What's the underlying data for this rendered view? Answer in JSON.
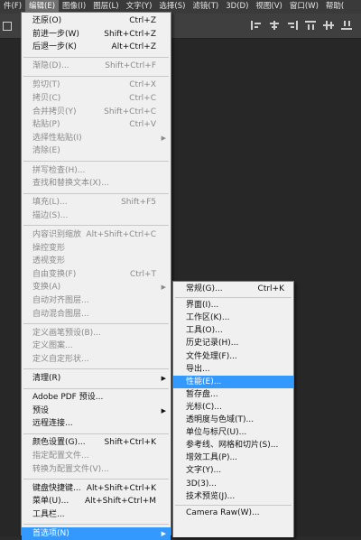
{
  "menubar": {
    "items": [
      {
        "label": "件(F)",
        "active": false
      },
      {
        "label": "编辑(E)",
        "active": true
      },
      {
        "label": "图像(I)",
        "active": false
      },
      {
        "label": "图层(L)",
        "active": false
      },
      {
        "label": "文字(Y)",
        "active": false
      },
      {
        "label": "选择(S)",
        "active": false
      },
      {
        "label": "滤镜(T)",
        "active": false
      },
      {
        "label": "3D(D)",
        "active": false
      },
      {
        "label": "视图(V)",
        "active": false
      },
      {
        "label": "窗口(W)",
        "active": false
      },
      {
        "label": "帮助(",
        "active": false
      }
    ]
  },
  "edit_menu": {
    "items": [
      {
        "label": "还原(O)",
        "shortcut": "Ctrl+Z",
        "disabled": false
      },
      {
        "label": "前进一步(W)",
        "shortcut": "Shift+Ctrl+Z",
        "disabled": false
      },
      {
        "label": "后退一步(K)",
        "shortcut": "Alt+Ctrl+Z",
        "disabled": false
      },
      {
        "sep": true
      },
      {
        "label": "渐隐(D)...",
        "shortcut": "Shift+Ctrl+F",
        "disabled": true
      },
      {
        "sep": true
      },
      {
        "label": "剪切(T)",
        "shortcut": "Ctrl+X",
        "disabled": true
      },
      {
        "label": "拷贝(C)",
        "shortcut": "Ctrl+C",
        "disabled": true
      },
      {
        "label": "合并拷贝(Y)",
        "shortcut": "Shift+Ctrl+C",
        "disabled": true
      },
      {
        "label": "粘贴(P)",
        "shortcut": "Ctrl+V",
        "disabled": true
      },
      {
        "label": "选择性粘贴(I)",
        "shortcut": "",
        "disabled": true,
        "submenu": true
      },
      {
        "label": "清除(E)",
        "shortcut": "",
        "disabled": true
      },
      {
        "sep": true
      },
      {
        "label": "拼写检查(H)...",
        "shortcut": "",
        "disabled": true
      },
      {
        "label": "查找和替换文本(X)...",
        "shortcut": "",
        "disabled": true
      },
      {
        "sep": true
      },
      {
        "label": "填充(L)...",
        "shortcut": "Shift+F5",
        "disabled": true
      },
      {
        "label": "描边(S)...",
        "shortcut": "",
        "disabled": true
      },
      {
        "sep": true
      },
      {
        "label": "内容识别缩放",
        "shortcut": "Alt+Shift+Ctrl+C",
        "disabled": true
      },
      {
        "label": "操控变形",
        "shortcut": "",
        "disabled": true
      },
      {
        "label": "透视变形",
        "shortcut": "",
        "disabled": true
      },
      {
        "label": "自由变换(F)",
        "shortcut": "Ctrl+T",
        "disabled": true
      },
      {
        "label": "变换(A)",
        "shortcut": "",
        "disabled": true,
        "submenu": true
      },
      {
        "label": "自动对齐图层...",
        "shortcut": "",
        "disabled": true
      },
      {
        "label": "自动混合图层...",
        "shortcut": "",
        "disabled": true
      },
      {
        "sep": true
      },
      {
        "label": "定义画笔预设(B)...",
        "shortcut": "",
        "disabled": true
      },
      {
        "label": "定义图案...",
        "shortcut": "",
        "disabled": true
      },
      {
        "label": "定义自定形状...",
        "shortcut": "",
        "disabled": true
      },
      {
        "sep": true
      },
      {
        "label": "清理(R)",
        "shortcut": "",
        "disabled": false,
        "submenu": true
      },
      {
        "sep": true
      },
      {
        "label": "Adobe PDF 预设...",
        "shortcut": "",
        "disabled": false
      },
      {
        "label": "预设",
        "shortcut": "",
        "disabled": false,
        "submenu": true
      },
      {
        "label": "远程连接...",
        "shortcut": "",
        "disabled": false
      },
      {
        "sep": true
      },
      {
        "label": "颜色设置(G)...",
        "shortcut": "Shift+Ctrl+K",
        "disabled": false
      },
      {
        "label": "指定配置文件...",
        "shortcut": "",
        "disabled": true
      },
      {
        "label": "转换为配置文件(V)...",
        "shortcut": "",
        "disabled": true
      },
      {
        "sep": true
      },
      {
        "label": "键盘快捷键...",
        "shortcut": "Alt+Shift+Ctrl+K",
        "disabled": false
      },
      {
        "label": "菜单(U)...",
        "shortcut": "Alt+Shift+Ctrl+M",
        "disabled": false
      },
      {
        "label": "工具栏...",
        "shortcut": "",
        "disabled": false
      },
      {
        "sep": true
      },
      {
        "label": "首选项(N)",
        "shortcut": "",
        "disabled": false,
        "submenu": true,
        "highlighted": true
      }
    ]
  },
  "prefs_submenu": {
    "items": [
      {
        "label": "常规(G)...",
        "shortcut": "Ctrl+K"
      },
      {
        "sep": true
      },
      {
        "label": "界面(I)..."
      },
      {
        "label": "工作区(K)..."
      },
      {
        "label": "工具(O)..."
      },
      {
        "label": "历史记录(H)..."
      },
      {
        "label": "文件处理(F)..."
      },
      {
        "label": "导出..."
      },
      {
        "label": "性能(E)...",
        "highlighted": true
      },
      {
        "label": "暂存盘..."
      },
      {
        "label": "光标(C)..."
      },
      {
        "label": "透明度与色域(T)..."
      },
      {
        "label": "单位与标尺(U)..."
      },
      {
        "label": "参考线、网格和切片(S)..."
      },
      {
        "label": "增效工具(P)..."
      },
      {
        "label": "文字(Y)..."
      },
      {
        "label": "3D(3)..."
      },
      {
        "label": "技术预览(J)..."
      },
      {
        "sep": true
      },
      {
        "label": "Camera Raw(W)..."
      }
    ]
  }
}
